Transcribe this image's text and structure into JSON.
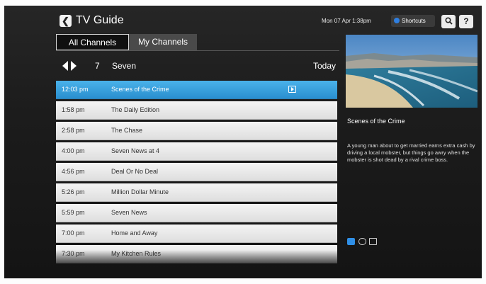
{
  "header": {
    "back_icon": "chevron-left-icon",
    "title": "TV Guide",
    "datetime": "Mon 07 Apr 1:38pm",
    "shortcuts_label": "Shortcuts",
    "search_icon": "search-icon",
    "help_icon": "help-icon",
    "help_glyph": "?"
  },
  "tabs": [
    {
      "label": "All Channels",
      "active": true
    },
    {
      "label": "My Channels",
      "active": false
    }
  ],
  "channel": {
    "number": "7",
    "name": "Seven",
    "day": "Today"
  },
  "programs": [
    {
      "time": "12:03 pm",
      "name": "Scenes of the Crime",
      "selected": true
    },
    {
      "time": "1:58 pm",
      "name": "The Daily Edition"
    },
    {
      "time": "2:58 pm",
      "name": "The Chase"
    },
    {
      "time": "4:00 pm",
      "name": "Seven News at 4"
    },
    {
      "time": "4:56 pm",
      "name": "Deal Or No Deal"
    },
    {
      "time": "5:26 pm",
      "name": "Million Dollar Minute"
    },
    {
      "time": "5:59 pm",
      "name": "Seven News"
    },
    {
      "time": "7:00 pm",
      "name": "Home and Away"
    },
    {
      "time": "7:30 pm",
      "name": "My Kitchen Rules"
    }
  ],
  "info": {
    "title": "Scenes of the Crime",
    "description": "A young man about to get married earns extra cash by driving a local mobster, but things go awry when the mobster is shot dead by a rival crime boss."
  },
  "colors": {
    "accent": "#3aa3e0",
    "background": "#1e1e1e"
  }
}
